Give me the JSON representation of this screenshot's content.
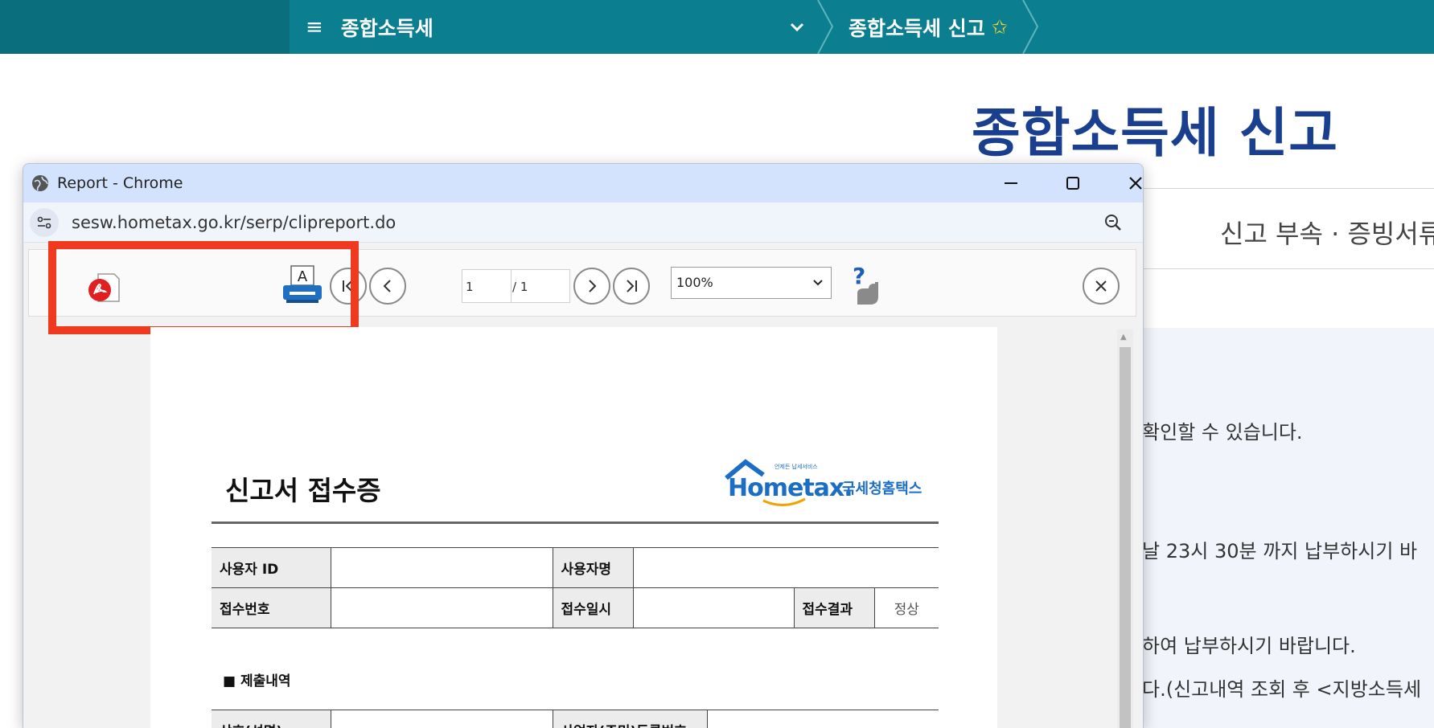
{
  "topnav": {
    "menu_label": "종합소득세",
    "breadcrumb_current": "종합소득세 신고",
    "star": "✩"
  },
  "page": {
    "title": "종합소득세 신고",
    "sub_tab": "신고 부속 · 증빙서류",
    "texts": [
      "확인할 수 있습니다.",
      "날 23시 30분 까지 납부하시기 바",
      "하여 납부하시기 바랍니다.",
      "다.(신고내역 조회 후 <지방소득세"
    ]
  },
  "popup": {
    "window_title": "Report - Chrome",
    "url": "sesw.hometax.go.kr/serp/clipreport.do",
    "toolbar": {
      "current_page": "1",
      "total_pages": "/ 1",
      "zoom": "100%",
      "print_letter": "A",
      "help_mark": "?"
    },
    "report": {
      "title": "신고서 접수증",
      "logo_text": "Hometax.",
      "logo_kr": "국세청홈택스",
      "logo_small": "언제든 납세서비스",
      "row1": {
        "user_id_label": "사용자 ID",
        "user_name_label": "사용자명"
      },
      "row2": {
        "receipt_no_label": "접수번호",
        "receipt_date_label": "접수일시",
        "result_label": "접수결과",
        "result_value": "정상"
      },
      "section": "■ 제출내역",
      "row3": {
        "company_label": "상호(성명)",
        "bizno_label": "사업자(주민)등록번호"
      }
    }
  },
  "colors": {
    "topbar": "#0b7f8f",
    "title_blue": "#1b3f8f",
    "highlight": "#f03a1f",
    "chrome_titlebar": "#d3e3fd"
  }
}
